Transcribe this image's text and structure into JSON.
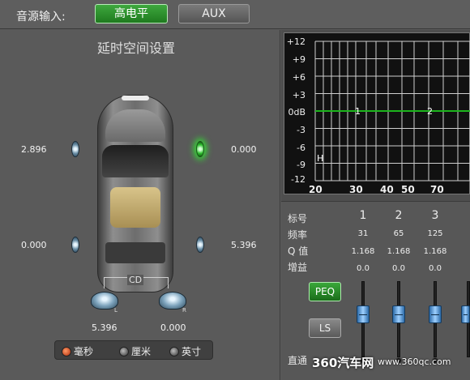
{
  "source": {
    "label": "音源输入:",
    "high_level": "高电平",
    "aux": "AUX"
  },
  "delay_panel": {
    "title": "延时空间设置",
    "front_left_value": "2.896",
    "front_right_value": "0.000",
    "rear_left_value": "0.000",
    "rear_right_value": "5.396",
    "sub_left_value": "5.396",
    "sub_right_value": "0.000",
    "sub_left_tag": "L",
    "sub_right_tag": "R",
    "center_label": "CD",
    "active_speaker": "front-right"
  },
  "units": {
    "ms": "毫秒",
    "cm": "厘米",
    "inch": "英寸",
    "selected": "ms"
  },
  "eq_graph": {
    "y_ticks": [
      "+12",
      "+9",
      "+6",
      "+3",
      "0dB",
      "-3",
      "-6",
      "-9",
      "-12"
    ],
    "x_ticks": [
      "20",
      "30",
      "40",
      "50",
      "70"
    ],
    "point_labels": [
      "1",
      "2"
    ],
    "marker": "H",
    "curve_color": "#1db51d"
  },
  "eq_params": {
    "row_labels": [
      "标号",
      "频率",
      "Q 值",
      "增益"
    ],
    "bands": [
      {
        "num": "1",
        "freq": "31",
        "q": "1.168",
        "gain": "0.0"
      },
      {
        "num": "2",
        "freq": "65",
        "q": "1.168",
        "gain": "0.0"
      },
      {
        "num": "3",
        "freq": "125",
        "q": "1.168",
        "gain": "0.0"
      }
    ],
    "peq_label": "PEQ",
    "ls_label": "LS",
    "bypass_label": "直通"
  },
  "watermark": {
    "brand": "360汽车网",
    "url": "www.360qc.com"
  }
}
